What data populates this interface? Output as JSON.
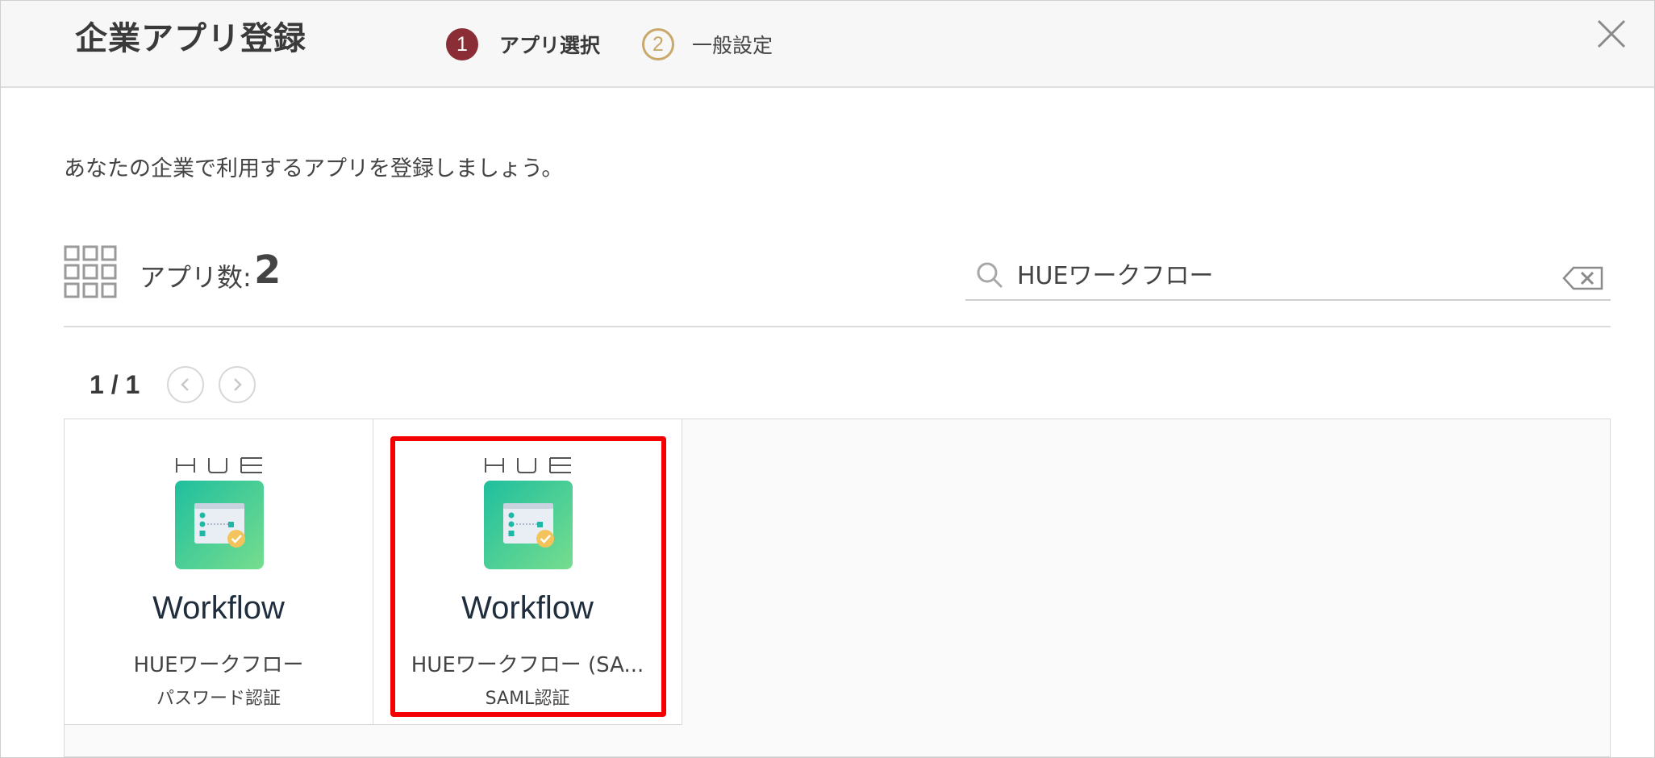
{
  "header": {
    "title": "企業アプリ登録",
    "steps": [
      {
        "number": "1",
        "label": "アプリ選択",
        "state": "active",
        "color": "#8a2d35"
      },
      {
        "number": "2",
        "label": "一般設定",
        "state": "inactive",
        "color": "#c8a96b"
      }
    ],
    "close_icon": "close-icon"
  },
  "intro_text": "あなたの企業で利用するアプリを登録しましょう。",
  "toolbar": {
    "grid_icon": "grid-icon",
    "count_label": "アプリ数:",
    "count_value": "2",
    "search": {
      "value": "HUEワークフロー",
      "icon": "search-icon",
      "clear_icon": "backspace-icon"
    }
  },
  "pagination": {
    "text": "1 / 1",
    "prev_icon": "chevron-left-icon",
    "next_icon": "chevron-right-icon"
  },
  "apps": [
    {
      "logo_text": "HUE",
      "icon_title": "Workflow",
      "name": "HUEワークフロー",
      "auth": "パスワード認証",
      "highlighted": false
    },
    {
      "logo_text": "HUE",
      "icon_title": "Workflow",
      "name": "HUEワークフロー (SA...",
      "auth": "SAML認証",
      "highlighted": true
    }
  ],
  "colors": {
    "accent": "#8a2d35",
    "highlight": "#f40000",
    "icon_gradient_start": "#1fbf9e",
    "icon_gradient_end": "#76dd8e"
  }
}
